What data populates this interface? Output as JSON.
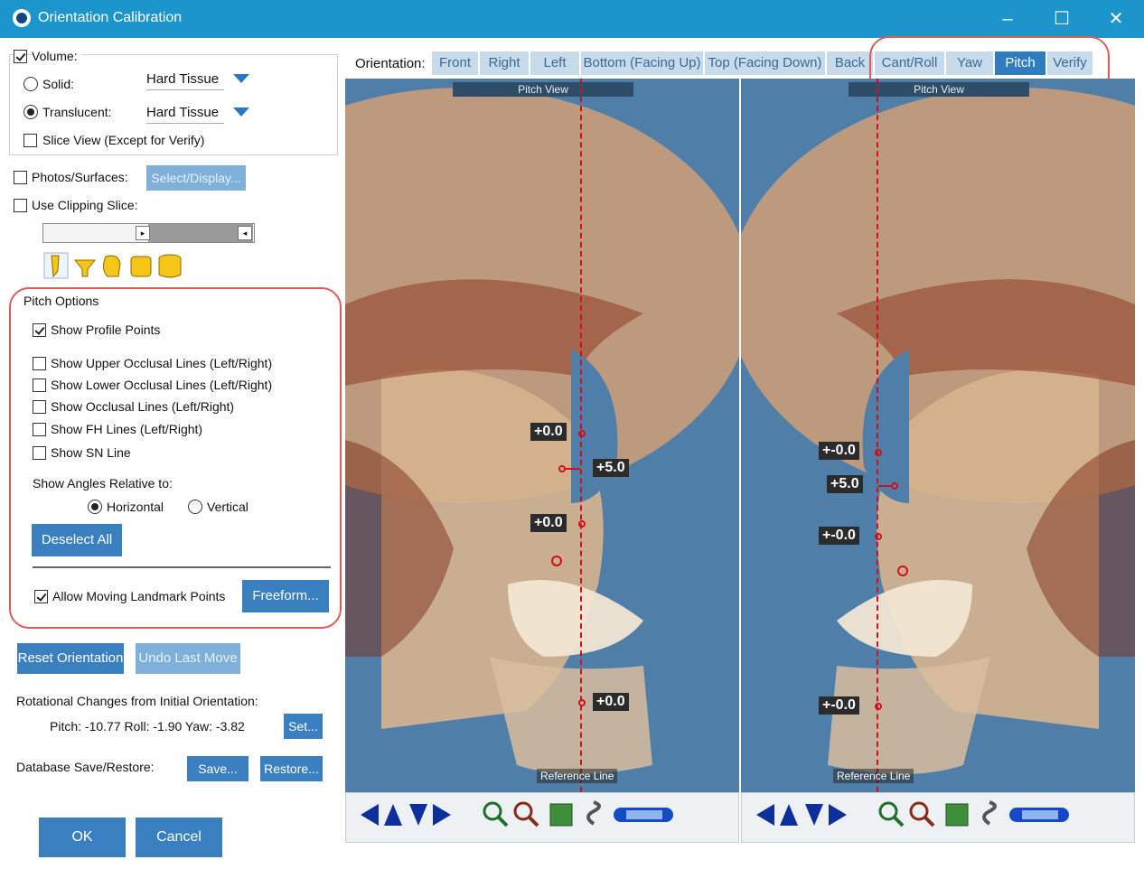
{
  "window": {
    "title": "Orientation Calibration",
    "minimize": "–",
    "maximize": "☐",
    "close": "✕"
  },
  "volume": {
    "label": "Volume:",
    "checked": true,
    "solid": {
      "label": "Solid:",
      "value": "Hard Tissue",
      "selected": false
    },
    "translucent": {
      "label": "Translucent:",
      "value": "Hard Tissue",
      "selected": true
    },
    "slice_view": {
      "label": "Slice View (Except for Verify)",
      "checked": false
    }
  },
  "photos": {
    "label": "Photos/Surfaces:",
    "button": "Select/Display..."
  },
  "clipping": {
    "label": "Use Clipping Slice:"
  },
  "pitch_options": {
    "title": "Pitch Options",
    "show_profile_points": "Show Profile Points",
    "upper_occlusal": "Show Upper Occlusal Lines (Left/Right)",
    "lower_occlusal": "Show Lower Occlusal Lines  (Left/Right)",
    "occlusal": "Show Occlusal Lines  (Left/Right)",
    "fh": "Show FH Lines  (Left/Right)",
    "sn": "Show SN Line",
    "angles_label": "Show Angles Relative to:",
    "horizontal": "Horizontal",
    "vertical": "Vertical",
    "deselect_all": "Deselect All",
    "allow_moving": "Allow Moving Landmark Points",
    "freeform": "Freeform..."
  },
  "reset_orientation": "Reset Orientation",
  "undo_last_move": "Undo Last Move",
  "rotational": {
    "label": "Rotational Changes from Initial Orientation:",
    "values": "Pitch: -10.77  Roll: -1.90  Yaw: -3.82",
    "set": "Set..."
  },
  "database": {
    "label": "Database Save/Restore:",
    "save": "Save...",
    "restore": "Restore..."
  },
  "ok": "OK",
  "cancel": "Cancel",
  "orientation": {
    "label": "Orientation:",
    "tabs": [
      "Front",
      "Right",
      "Left",
      "Bottom (Facing Up)",
      "Top (Facing Down)",
      "Back",
      "Cant/Roll",
      "Yaw",
      "Pitch",
      "Verify"
    ],
    "active": "Pitch"
  },
  "left_view": {
    "title": "Pitch View",
    "ref": "Reference Line",
    "m1": "+0.0",
    "m2": "+5.0",
    "m3": "+0.0",
    "m4": "+0.0"
  },
  "right_view": {
    "title": "Pitch View",
    "ref": "Reference Line",
    "m1": "+-0.0",
    "m2": "+5.0",
    "m3": "+-0.0",
    "m4": "+-0.0"
  },
  "colors": {
    "titlebar": "#1c94cc",
    "button": "#3a7fbf",
    "tab_active": "#2f7cc0",
    "highlight": "#e05a5a",
    "reference_line": "#d0101a"
  }
}
